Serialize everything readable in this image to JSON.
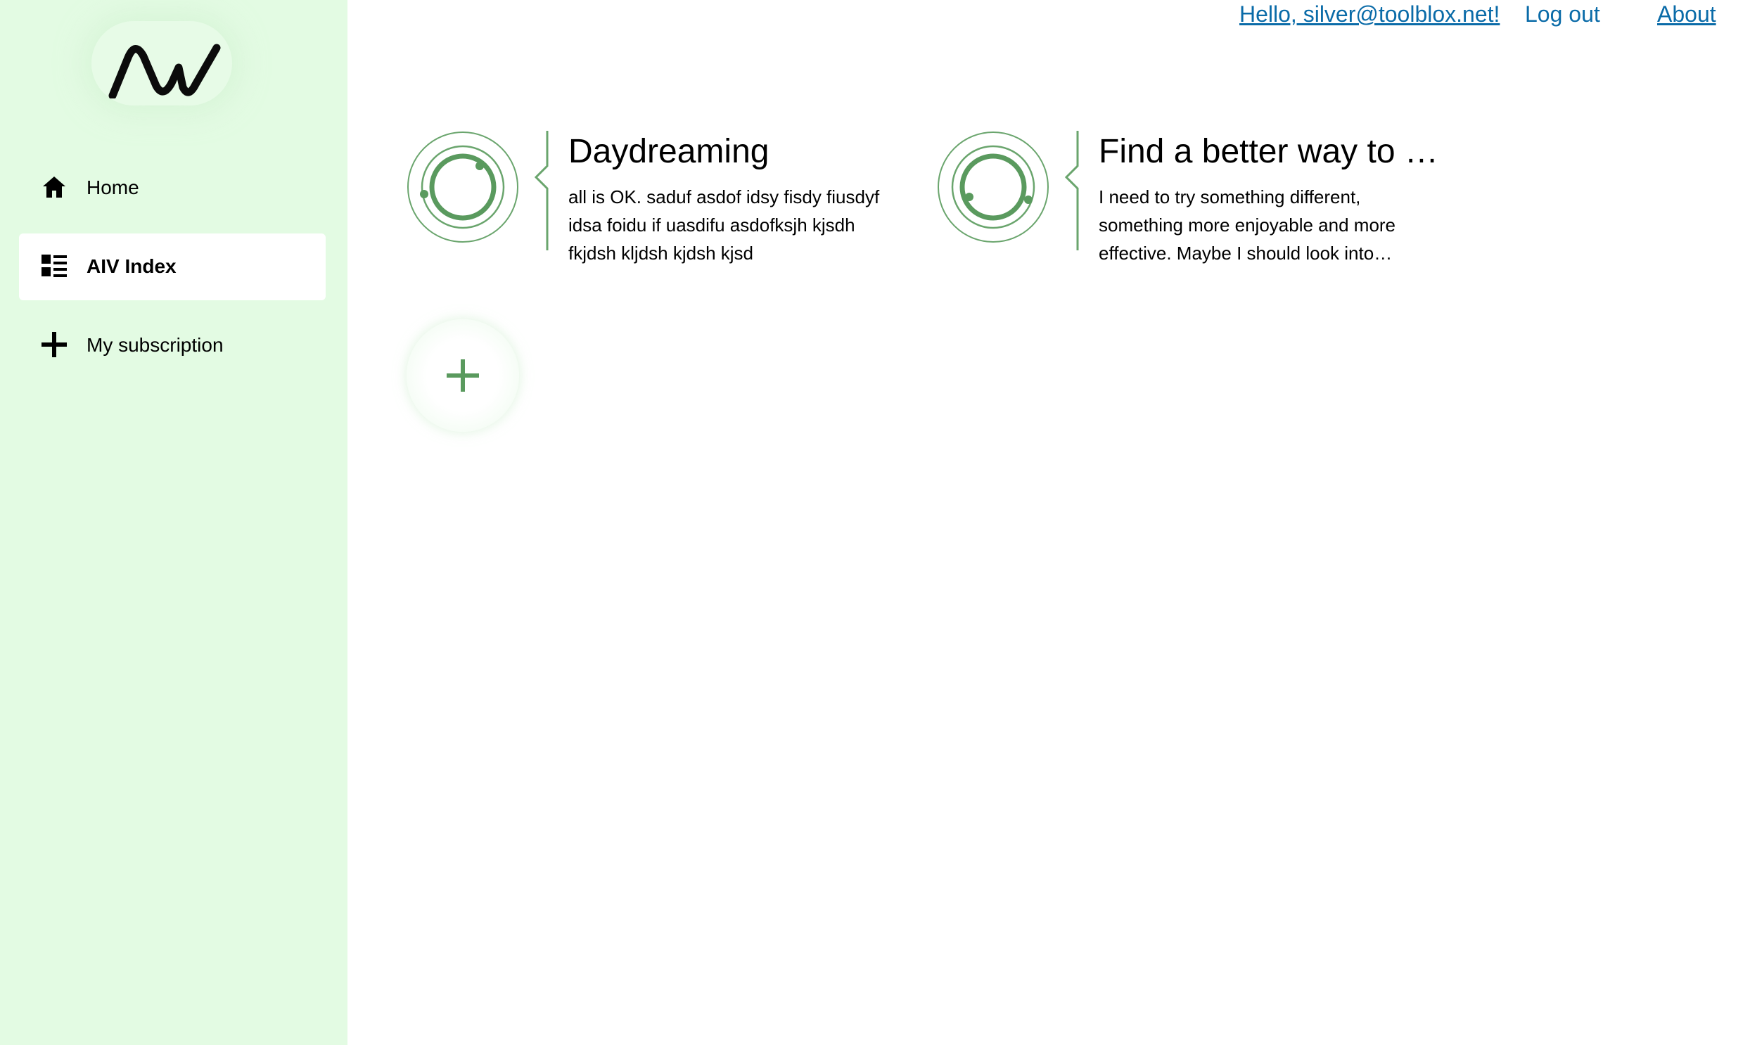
{
  "app": {
    "logo_text": "AIV"
  },
  "sidebar": {
    "items": [
      {
        "label": "Home",
        "icon": "home-icon",
        "active": false
      },
      {
        "label": "AIV Index",
        "icon": "dashboard-list-icon",
        "active": true
      },
      {
        "label": "My subscription",
        "icon": "plus-icon",
        "active": false
      }
    ]
  },
  "header": {
    "greeting": "Hello, silver@toolblox.net!",
    "logout": "Log out",
    "about": "About"
  },
  "cards": [
    {
      "title": "Daydreaming",
      "description": "all is OK. saduf asdof idsy fisdy fiusdyf idsa foidu if uasdifu asdofksjh kjsdh fkjdsh kljdsh kjdsh kjsd",
      "icon": "orbit-icon"
    },
    {
      "title": "Find a better way to …",
      "description": "I need to try something different, something more enjoyable and more effective. Maybe I should look into…",
      "icon": "orbit-icon"
    }
  ],
  "add_button": {
    "icon": "plus-icon"
  },
  "colors": {
    "sidebar_bg": "#e3fbe3",
    "accent_green": "#5a9a5e",
    "link_blue": "#0a6ba8"
  }
}
